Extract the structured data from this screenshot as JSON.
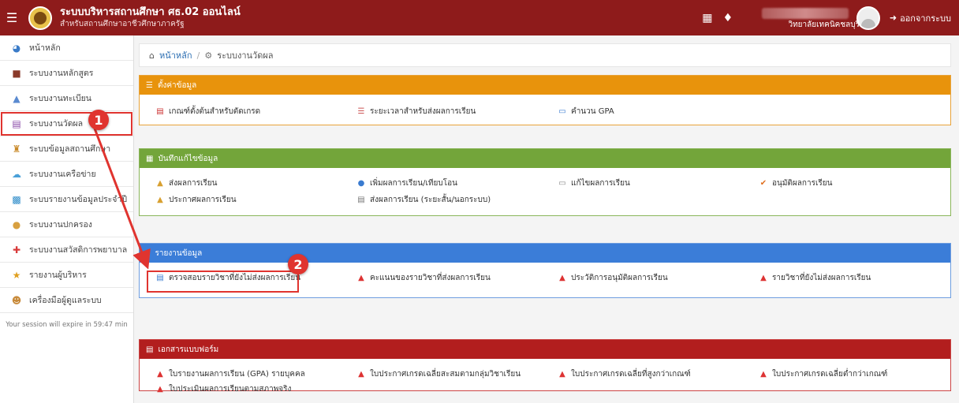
{
  "header": {
    "title": "ระบบบริหารสถานศึกษา ศธ.02 ออนไลน์",
    "subtitle": "สำหรับสถานศึกษาอาชีวศึกษาภาครัฐ",
    "college": "วิทยาลัยเทคนิคชลบุรี",
    "logout": "ออกจากระบบ"
  },
  "sidebar": {
    "items": [
      {
        "label": "หน้าหลัก",
        "icon": "dashboard-icon"
      },
      {
        "label": "ระบบงานหลักสูตร",
        "icon": "book-icon"
      },
      {
        "label": "ระบบงานทะเบียน",
        "icon": "registry-icon"
      },
      {
        "label": "ระบบงานวัดผล",
        "icon": "calendar-icon"
      },
      {
        "label": "ระบบข้อมูลสถานศึกษา",
        "icon": "school-icon"
      },
      {
        "label": "ระบบงานเครือข่าย",
        "icon": "cloud-icon"
      },
      {
        "label": "ระบบรายงานข้อมูลประจำปี",
        "icon": "report-icon"
      },
      {
        "label": "ระบบงานปกครอง",
        "icon": "person-icon"
      },
      {
        "label": "ระบบงานสวัสดิการพยาบาล",
        "icon": "first-aid-icon"
      },
      {
        "label": "รายงานผู้บริหาร",
        "icon": "executive-icon"
      },
      {
        "label": "เครื่องมือผู้ดูแลระบบ",
        "icon": "users-icon"
      }
    ],
    "session": "Your session will expire in 59:47 min"
  },
  "breadcrumb": {
    "home": "หน้าหลัก",
    "separator": "/",
    "current": "ระบบงานวัดผล"
  },
  "panels": {
    "settings": {
      "title": "ตั้งค่าข้อมูล",
      "links": [
        "เกณฑ์ตั้งต้นสำหรับตัดเกรด",
        "ระยะเวลาสำหรับส่งผลการเรียน",
        "คำนวน GPA"
      ]
    },
    "record": {
      "title": "บันทึกแก้ไขข้อมูล",
      "links": [
        "ส่งผลการเรียน",
        "เพิ่มผลการเรียน/เทียบโอน",
        "แก้ไขผลการเรียน",
        "อนุมัติผลการเรียน",
        "ประกาศผลการเรียน",
        "ส่งผลการเรียน (ระยะสั้น/นอกระบบ)"
      ]
    },
    "report": {
      "title": "รายงานข้อมูล",
      "links": [
        "ตรวจสอบรายวิชาที่ยังไม่ส่งผลการเรียน",
        "คะแนนของรายวิชาที่ส่งผลการเรียน",
        "ประวัติการอนุมัติผลการเรียน",
        "รายวิชาที่ยังไม่ส่งผลการเรียน"
      ]
    },
    "forms": {
      "title": "เอกสารแบบฟอร์ม",
      "links": [
        "ใบรายงานผลการเรียน (GPA) รายบุคคล",
        "ใบประกาศเกรดเฉลี่ยสะสมตามกลุ่มวิชาเรียน",
        "ใบประกาศเกรดเฉลี่ยที่สูงกว่าเกณฑ์",
        "ใบประกาศเกรดเฉลี่ยต่ำกว่าเกณฑ์",
        "ใบประเมินผลการเรียนตามสภาพจริง"
      ]
    }
  },
  "annotations": {
    "step1": "1",
    "step2": "2"
  },
  "colors": {
    "header": "#8e1b1b",
    "settings": "#e8930c",
    "record": "#73a53a",
    "report": "#3b7dd8",
    "forms": "#b21e1e",
    "highlight": "#e0342f"
  }
}
